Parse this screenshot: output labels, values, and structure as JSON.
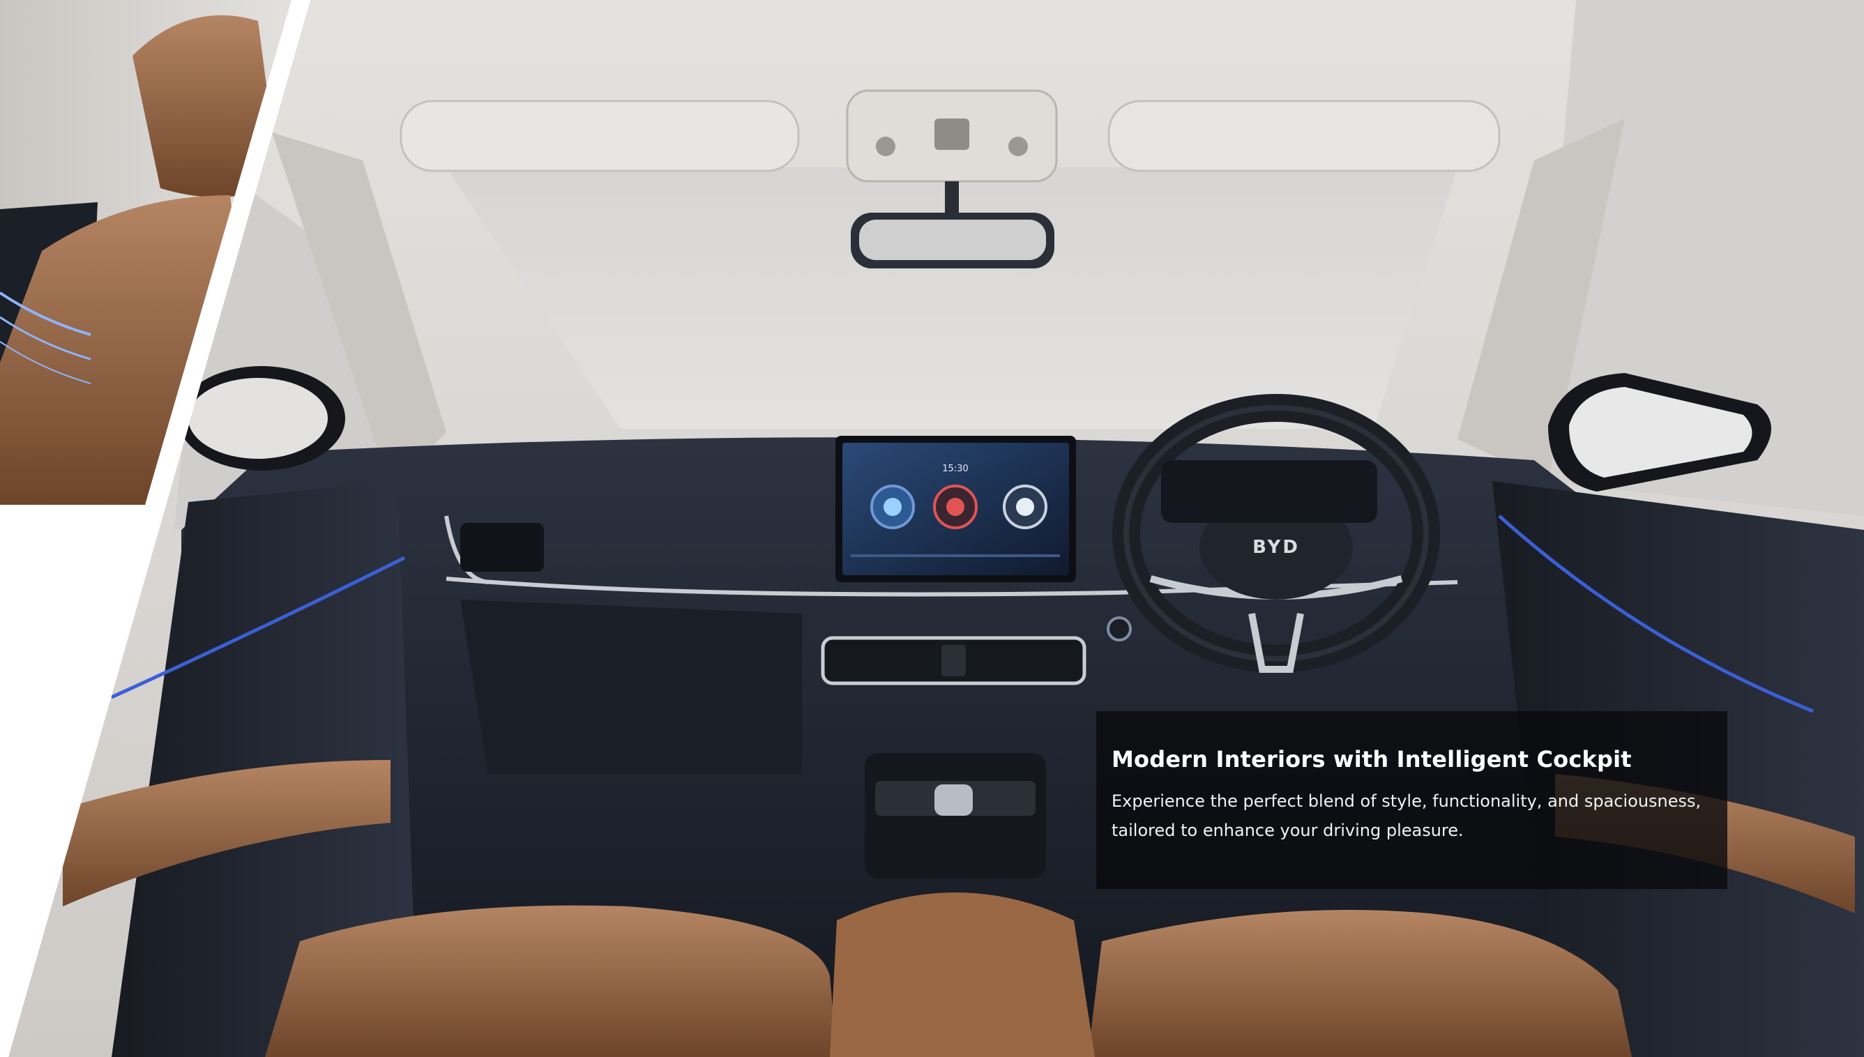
{
  "caption": {
    "title": "Modern Interiors with Intelligent Cockpit",
    "body_line_1": "Experience the perfect blend of style, functionality, and spaciousness,",
    "body_line_2": "tailored to enhance your driving pleasure."
  },
  "infotainment": {
    "clock": "15:30"
  },
  "steering_wheel": {
    "logo": "BYD"
  },
  "colors": {
    "headliner": "#d9d6d2",
    "dashboard": "#1f2430",
    "leather": "#9a6844",
    "ambient_light": "#3b5fd6",
    "caption_bg": "#08090c"
  }
}
